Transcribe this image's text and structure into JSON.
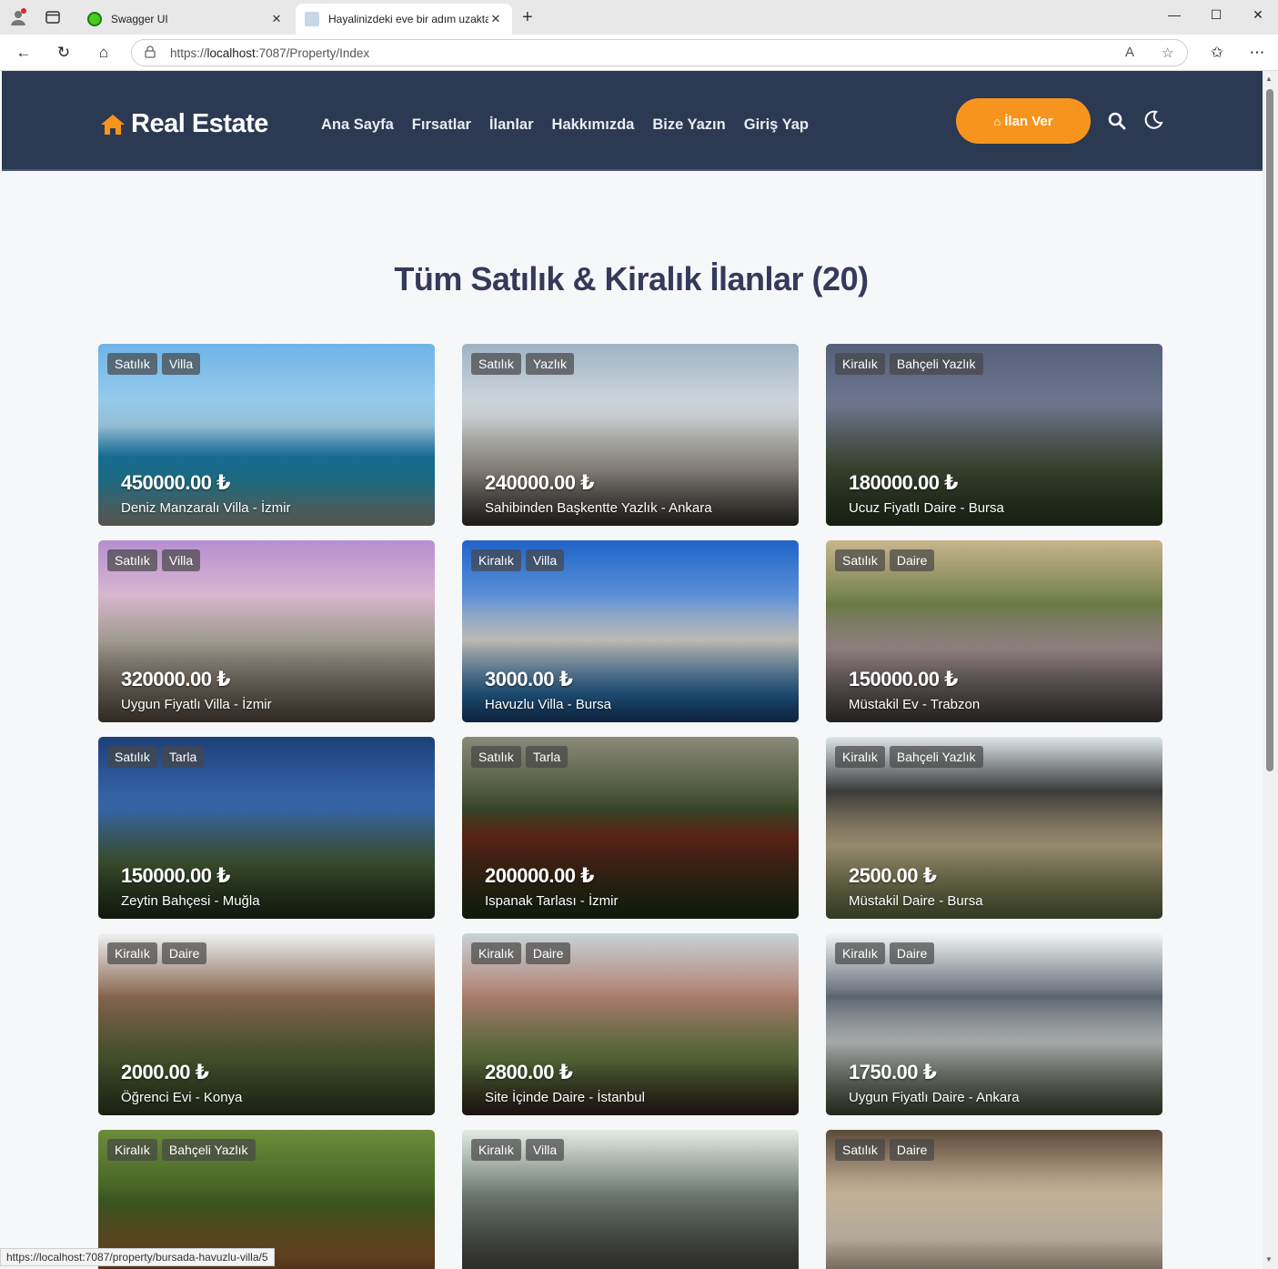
{
  "browser": {
    "tabs": [
      {
        "title": "Swagger UI",
        "favicon_color": "#49cc21"
      },
      {
        "title": "Hayalinizdeki eve bir adım uzakta",
        "favicon_color": "#c8d6ea"
      }
    ],
    "url_prefix": "https://",
    "url_host": "localhost",
    "url_rest": ":7087/Property/Index",
    "status_url": "https://localhost:7087/property/bursada-havuzlu-villa/5"
  },
  "navbar": {
    "brand": "Real Estate",
    "links": [
      "Ana Sayfa",
      "Fırsatlar",
      "İlanlar",
      "Hakkımızda",
      "Bize Yazın",
      "Giriş Yap"
    ],
    "cta_label": "İlan Ver",
    "colors": {
      "bg": "#2b3a52",
      "accent": "#f7941d"
    }
  },
  "heading": "Tüm Satılık & Kiralık İlanlar (20)",
  "listings": [
    {
      "status": "Satılık",
      "type": "Villa",
      "price": "450000.00 ₺",
      "title": "Deniz Manzaralı Villa - İzmir"
    },
    {
      "status": "Satılık",
      "type": "Yazlık",
      "price": "240000.00 ₺",
      "title": "Sahibinden Başkentte Yazlık - Ankara"
    },
    {
      "status": "Kiralık",
      "type": "Bahçeli Yazlık",
      "price": "180000.00 ₺",
      "title": "Ucuz Fiyatlı Daire - Bursa"
    },
    {
      "status": "Satılık",
      "type": "Villa",
      "price": "320000.00 ₺",
      "title": "Uygun Fiyatlı Villa - İzmir"
    },
    {
      "status": "Kiralık",
      "type": "Villa",
      "price": "3000.00 ₺",
      "title": "Havuzlu Villa - Bursa"
    },
    {
      "status": "Satılık",
      "type": "Daire",
      "price": "150000.00 ₺",
      "title": "Müstakil Ev - Trabzon"
    },
    {
      "status": "Satılık",
      "type": "Tarla",
      "price": "150000.00 ₺",
      "title": "Zeytin Bahçesi - Muğla"
    },
    {
      "status": "Satılık",
      "type": "Tarla",
      "price": "200000.00 ₺",
      "title": "Ispanak Tarlası - İzmir"
    },
    {
      "status": "Kiralık",
      "type": "Bahçeli Yazlık",
      "price": "2500.00 ₺",
      "title": "Müstakil Daire - Bursa"
    },
    {
      "status": "Kiralık",
      "type": "Daire",
      "price": "2000.00 ₺",
      "title": "Öğrenci Evi - Konya"
    },
    {
      "status": "Kiralık",
      "type": "Daire",
      "price": "2800.00 ₺",
      "title": "Site İçinde Daire - İstanbul"
    },
    {
      "status": "Kiralık",
      "type": "Daire",
      "price": "1750.00 ₺",
      "title": "Uygun Fiyatlı Daire - Ankara"
    },
    {
      "status": "Kiralık",
      "type": "Bahçeli Yazlık",
      "price": "",
      "title": ""
    },
    {
      "status": "Kiralık",
      "type": "Villa",
      "price": "",
      "title": ""
    },
    {
      "status": "Satılık",
      "type": "Daire",
      "price": "",
      "title": ""
    }
  ]
}
